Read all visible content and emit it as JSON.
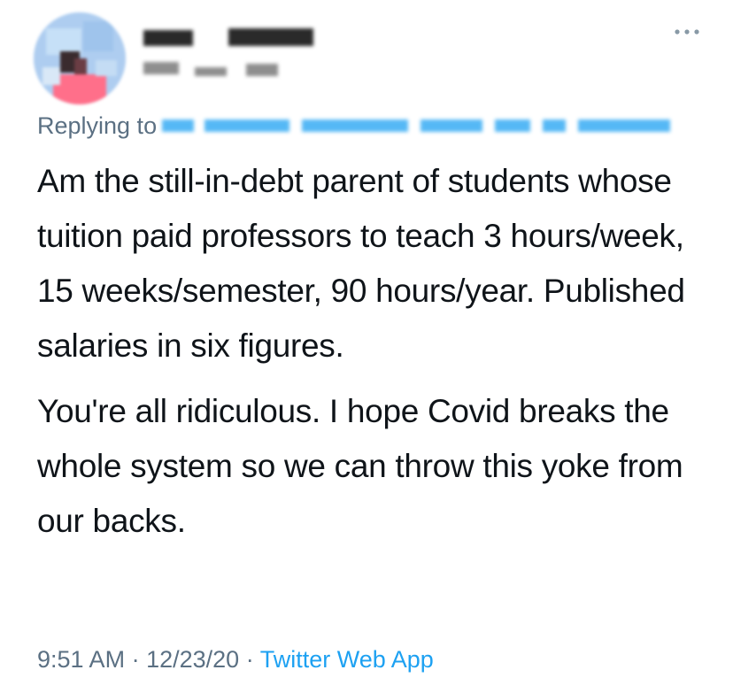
{
  "tweet": {
    "replying_to_label": "Replying to",
    "paragraphs": [
      "Am the still-in-debt parent of students whose tuition paid professors to teach 3 hours/week, 15 weeks/semester, 90 hours/year. Published salaries in six figures.",
      "You're all ridiculous. I hope Covid breaks the whole system so we can throw this yoke from our backs."
    ],
    "time": "9:51 AM",
    "separator": "·",
    "date": "12/23/20",
    "source": "Twitter Web App",
    "more_icon": "more-horizontal-icon"
  },
  "colors": {
    "text": "#0f1419",
    "secondary": "#5b7083",
    "accent": "#1da1f2",
    "avatar_bg": "#b9d7f2"
  }
}
